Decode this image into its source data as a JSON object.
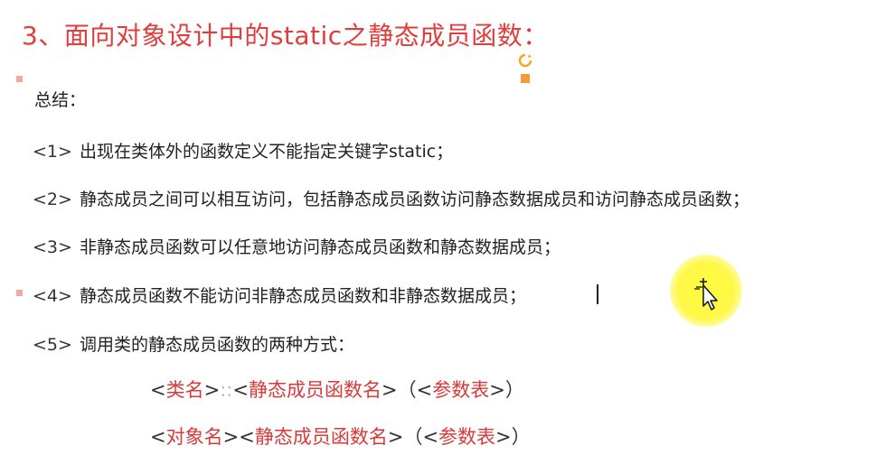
{
  "title": "3、面向对象设计中的static之静态成员函数：",
  "summary_label": "总结：",
  "items": [
    {
      "num": "<1>",
      "text": "出现在类体外的函数定义不能指定关键字static；"
    },
    {
      "num": "<2>",
      "text": "静态成员之间可以相互访问，包括静态成员函数访问静态数据成员和访问静态成员函数；"
    },
    {
      "num": "<3>",
      "text": "非静态成员函数可以任意地访问静态成员函数和静态数据成员；"
    },
    {
      "num": "<4>",
      "text": "静态成员函数不能访问非静态成员函数和非静态数据成员；"
    },
    {
      "num": "<5>",
      "text": "调用类的静态成员函数的两种方式："
    }
  ],
  "syntax1": {
    "lt1": "<",
    "class_name": "类名",
    "gt1": ">",
    "sep": "::",
    "lt2": "<",
    "func_name": "静态成员函数名",
    "gt2": ">",
    "open": "（",
    "lt3": "<",
    "params": "参数表",
    "gt3": ">",
    "close": "）"
  },
  "syntax2": {
    "lt1": "<",
    "object_name": "对象名",
    "gt1": ">",
    "lt2": "<",
    "func_name": "静态成员函数名",
    "gt2": ">",
    "open": "（",
    "lt3": "<",
    "params": "参数表",
    "gt3": ">",
    "close": "）"
  },
  "colors": {
    "title": "#e23c3c",
    "keyword": "#d83a3a",
    "cursor_highlight": "#fff84a",
    "orange_marker": "#f59a3a"
  },
  "icons": [
    "refresh-icon",
    "pointer-cursor-icon"
  ]
}
